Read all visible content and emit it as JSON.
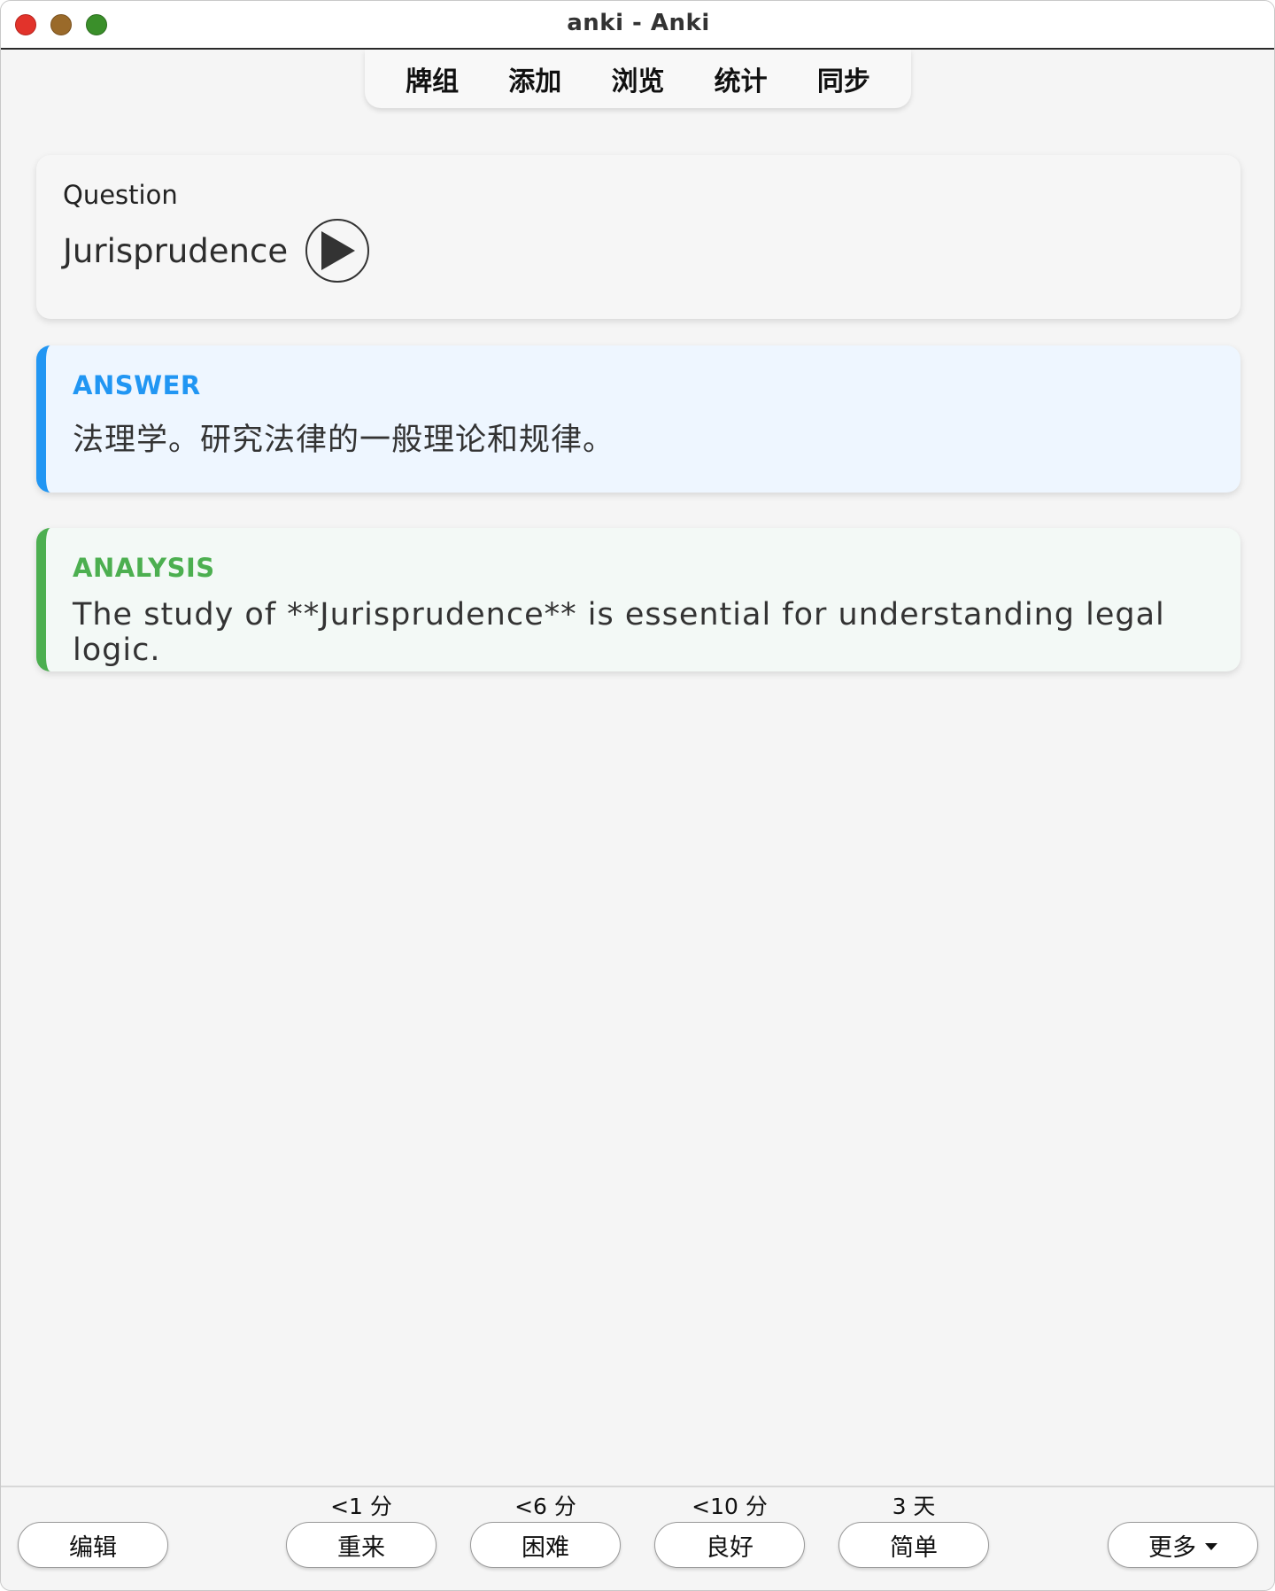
{
  "window": {
    "title": "anki - Anki"
  },
  "topnav": {
    "items": [
      "牌组",
      "添加",
      "浏览",
      "统计",
      "同步"
    ]
  },
  "question": {
    "label": "Question",
    "word": "Jurisprudence",
    "play_icon": "play-icon"
  },
  "answer": {
    "label": "ANSWER",
    "text": "法理学。研究法律的一般理论和规律。",
    "accent": "#2196f3"
  },
  "analysis": {
    "label": "ANALYSIS",
    "text": "The study of **Jurisprudence** is essential for understanding legal logic.",
    "accent": "#4caf50"
  },
  "bottom": {
    "edit_label": "编辑",
    "more_label": "更多",
    "ease_buttons": [
      {
        "label": "重来",
        "interval": "<1 分"
      },
      {
        "label": "困难",
        "interval": "<6 分"
      },
      {
        "label": "良好",
        "interval": "<10 分"
      },
      {
        "label": "简单",
        "interval": "3 天"
      }
    ]
  }
}
